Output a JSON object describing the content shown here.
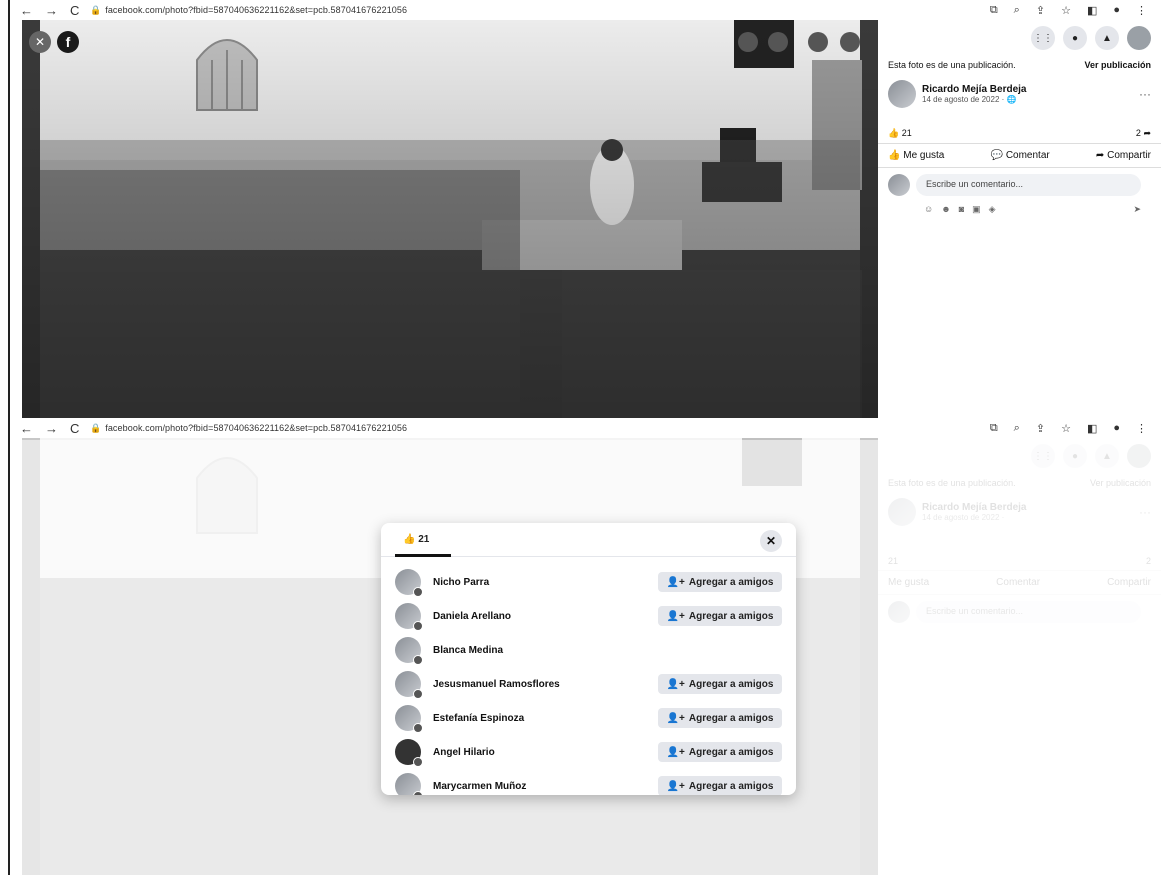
{
  "browser": {
    "url": "facebook.com/photo?fbid=587040636221162&set=pcb.587041676221056",
    "back_icon": "←",
    "forward_icon": "→",
    "reload_icon": "C"
  },
  "photo_viewer": {
    "close_icon": "✕",
    "logo_letter": "f",
    "zoom_in_icon": "⊕",
    "zoom_out_icon": "⊖",
    "tag_icon": "tag",
    "fullscreen_icon": "⤢"
  },
  "side_panel": {
    "post_notice": "Esta foto es de una publicación.",
    "view_post": "Ver publicación",
    "author_name": "Ricardo Mejía Berdeja",
    "post_date": "14 de agosto de 2022 · ",
    "reactions_count": "21",
    "shares_count": "2",
    "like_label": "Me gusta",
    "comment_label": "Comentar",
    "share_label": "Compartir",
    "comment_placeholder": "Escribe un comentario...",
    "more": "···"
  },
  "reactions_modal": {
    "tab_label": "21",
    "close": "✕",
    "add_friend_label": "Agregar a amigos",
    "people": [
      {
        "name": "Nicho Parra",
        "button": true
      },
      {
        "name": "Daniela Arellano",
        "button": true
      },
      {
        "name": "Blanca Medina",
        "button": false
      },
      {
        "name": "Jesusmanuel Ramosflores",
        "button": true
      },
      {
        "name": "Estefanía Espinoza",
        "button": true
      },
      {
        "name": "Angel Hilario",
        "button": true
      },
      {
        "name": "Marycarmen Muñoz",
        "button": true
      }
    ]
  }
}
